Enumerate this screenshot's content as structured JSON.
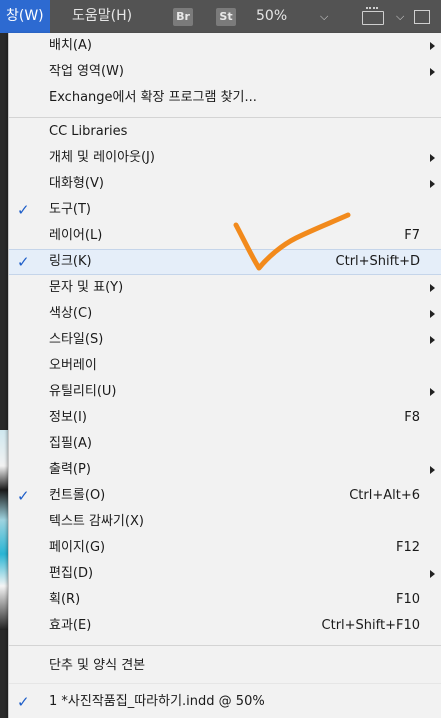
{
  "menubar": {
    "window": "창(W)",
    "help": "도움말(H)",
    "br": "Br",
    "st": "St",
    "zoom": "50%"
  },
  "menu": {
    "items": [
      {
        "label": "배치(A)",
        "submenu": true
      },
      {
        "label": "작업 영역(W)",
        "submenu": true
      },
      {
        "label": "Exchange에서 확장 프로그램 찾기..."
      },
      {
        "label": "CC Libraries"
      },
      {
        "label": "개체 및 레이아웃(J)",
        "submenu": true
      },
      {
        "label": "대화형(V)",
        "submenu": true
      },
      {
        "label": "도구(T)",
        "checked": true
      },
      {
        "label": "레이어(L)",
        "shortcut": "F7"
      },
      {
        "label": "링크(K)",
        "shortcut": "Ctrl+Shift+D",
        "checked": true,
        "highlighted": true
      },
      {
        "label": "문자 및 표(Y)",
        "submenu": true
      },
      {
        "label": "색상(C)",
        "submenu": true
      },
      {
        "label": "스타일(S)",
        "submenu": true
      },
      {
        "label": "오버레이"
      },
      {
        "label": "유틸리티(U)",
        "submenu": true
      },
      {
        "label": "정보(I)",
        "shortcut": "F8"
      },
      {
        "label": "집필(A)"
      },
      {
        "label": "출력(P)",
        "submenu": true
      },
      {
        "label": "컨트롤(O)",
        "shortcut": "Ctrl+Alt+6",
        "checked": true
      },
      {
        "label": "텍스트 감싸기(X)"
      },
      {
        "label": "페이지(G)",
        "shortcut": "F12"
      },
      {
        "label": "편집(D)",
        "submenu": true
      },
      {
        "label": "획(R)",
        "shortcut": "F10"
      },
      {
        "label": "효과(E)",
        "shortcut": "Ctrl+Shift+F10"
      },
      {
        "label": "단추 및 양식 견본"
      },
      {
        "label": "1 *사진작품집_따라하기.indd @ 50%",
        "checked": true
      }
    ]
  },
  "colors": {
    "menubar_bg": "#535353",
    "active_menu": "#2d6ad1",
    "menu_bg": "#f2f2f2",
    "highlight_bg": "#e5eef9",
    "check": "#1f5fc9",
    "annotation_mark": "#f28a1c"
  }
}
